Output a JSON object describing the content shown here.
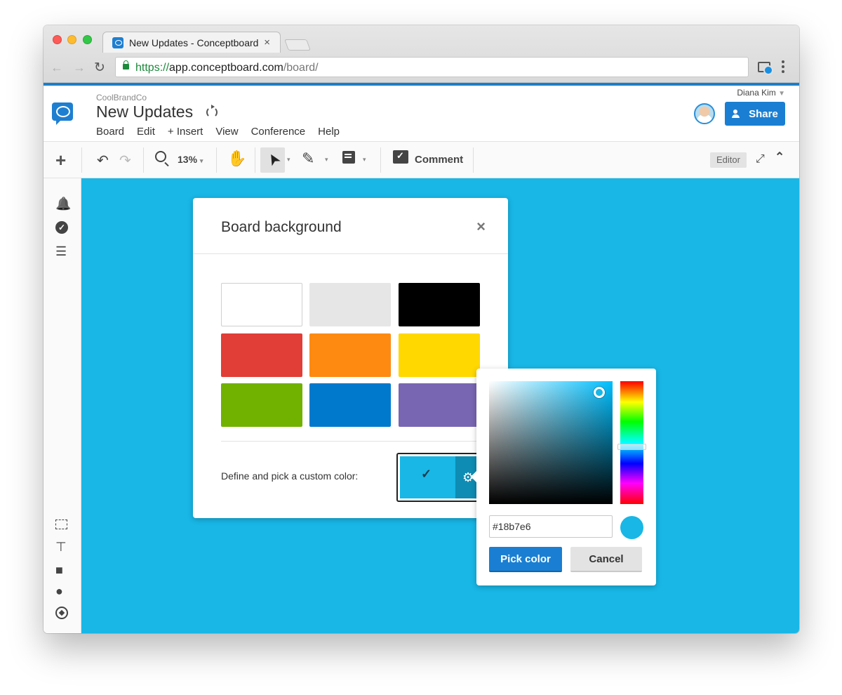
{
  "browser": {
    "tab_title": "New Updates - Conceptboard",
    "tab_close": "×",
    "url_protocol": "https://",
    "url_host": "app.conceptboard.com",
    "url_path": "/board/",
    "back": "←",
    "forward": "→",
    "reload": "↻"
  },
  "header": {
    "org": "CoolBrandCo",
    "board_title": "New Updates",
    "menu": [
      "Board",
      "Edit",
      "+ Insert",
      "View",
      "Conference",
      "Help"
    ],
    "user_name": "Diana Kim",
    "user_caret": "▼",
    "share_label": "Share"
  },
  "toolbar": {
    "plus": "+",
    "undo": "↶",
    "redo": "↷",
    "zoom": "13%",
    "caret": "▾",
    "hand": "✋",
    "pointer": "➤",
    "pen": "✎",
    "comment_label": "Comment",
    "editor_label": "Editor",
    "fullscreen": "⤢",
    "collapse": "⌃"
  },
  "sidebar": {
    "bell": "🔔",
    "check": "✓",
    "list": "☰",
    "present": "⊤",
    "video": "■",
    "chat": "●"
  },
  "dialog": {
    "title": "Board background",
    "close": "×",
    "swatches": [
      "#ffffff",
      "#e6e6e6",
      "#000000",
      "#e03e36",
      "#ff8a11",
      "#ffd800",
      "#71b100",
      "#0079cc",
      "#7866b2"
    ],
    "custom_label": "Define and pick a custom color:",
    "custom_check": "✓",
    "gear": "⚙"
  },
  "picker": {
    "hex_value": "#18b7e6",
    "pick_label": "Pick color",
    "cancel_label": "Cancel"
  },
  "colors": {
    "canvas": "#18b7e6",
    "accent": "#1a7fd2"
  }
}
